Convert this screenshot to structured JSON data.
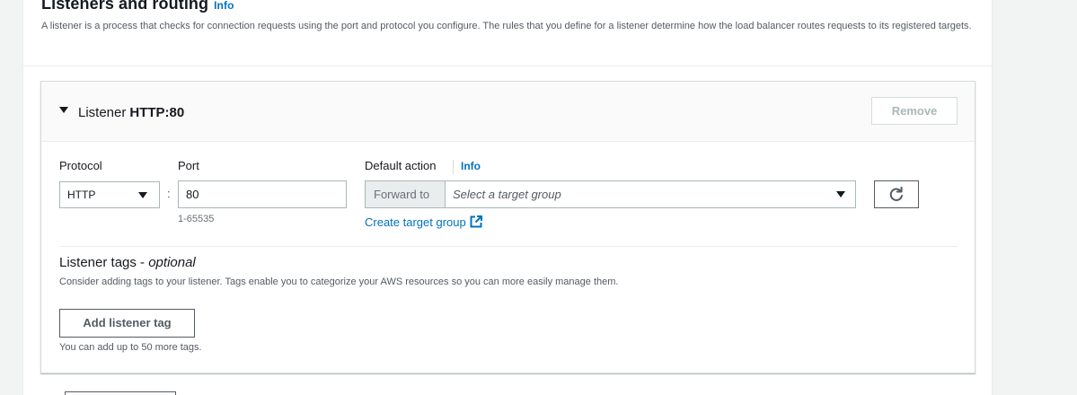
{
  "section": {
    "title": "Listeners and routing",
    "info_label": "Info",
    "description": "A listener is a process that checks for connection requests using the port and protocol you configure. The rules that you define for a listener determine how the load balancer routes requests to its registered targets."
  },
  "listener": {
    "title_prefix": "Listener",
    "title_value": "HTTP:80",
    "remove_label": "Remove",
    "protocol": {
      "label": "Protocol",
      "value": "HTTP"
    },
    "port": {
      "label": "Port",
      "value": "80",
      "hint": "1-65535"
    },
    "default_action": {
      "label": "Default action",
      "info_label": "Info",
      "forward_label": "Forward to",
      "placeholder": "Select a target group",
      "create_link": "Create target group"
    },
    "tags": {
      "title": "Listener tags - ",
      "title_optional": "optional",
      "description": "Consider adding tags to your listener. Tags enable you to categorize your AWS resources so you can more easily manage them.",
      "add_button": "Add listener tag",
      "hint": "You can add up to 50 more tags."
    }
  },
  "colors": {
    "link": "#0073bb",
    "text": "#16191f",
    "muted": "#545b64",
    "border": "#aab7b8",
    "background": "#f2f3f3"
  },
  "icons": [
    "caret-down-icon",
    "dropdown-arrow-icon",
    "refresh-icon",
    "external-link-icon"
  ]
}
